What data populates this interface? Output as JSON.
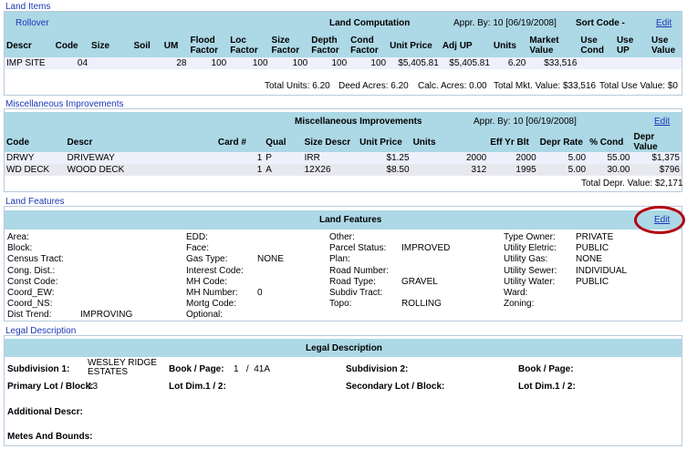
{
  "land_items": {
    "section_label": "Land Items",
    "rollover": "Rollover",
    "title": "Land Computation",
    "appr_by": "Appr. By: 10 [06/19/2008]",
    "sort_code": "Sort Code -",
    "edit": "Edit",
    "columns": [
      "Descr",
      "Code",
      "Size",
      "Soil",
      "UM",
      "Flood Factor",
      "Loc Factor",
      "Size Factor",
      "Depth Factor",
      "Cond Factor",
      "Unit Price",
      "Adj UP",
      "Units",
      "Market Value",
      "Use Cond",
      "Use UP",
      "Use Value"
    ],
    "rows": [
      [
        "IMP SITE",
        "04",
        "",
        "",
        "28",
        "100",
        "100",
        "100",
        "100",
        "100",
        "$5,405.81",
        "$5,405.81",
        "6.20",
        "$33,516",
        "",
        "",
        ""
      ]
    ],
    "totals": {
      "units": "Total Units: 6.20",
      "deed": "Deed Acres: 6.20",
      "calc": "Calc. Acres: 0.00",
      "mkt": "Total Mkt. Value: $33,516",
      "use": "Total Use Value: $0"
    }
  },
  "misc": {
    "section_label": "Miscellaneous Improvements",
    "title": "Miscellaneous Improvements",
    "appr_by": "Appr. By: 10 [06/19/2008]",
    "edit": "Edit",
    "columns": [
      "Code",
      "Descr",
      "Card #",
      "Qual",
      "Size Descr",
      "Unit Price",
      "Units",
      "Eff Yr Blt",
      "Depr Rate",
      "% Cond",
      "Depr Value"
    ],
    "rows": [
      [
        "DRWY",
        "DRIVEWAY",
        "1",
        "P",
        "IRR",
        "$1.25",
        "2000",
        "2000",
        "5.00",
        "55.00",
        "$1,375"
      ],
      [
        "WD DECK",
        "WOOD DECK",
        "1",
        "A",
        "12X26",
        "$8.50",
        "312",
        "1995",
        "5.00",
        "30.00",
        "$796"
      ]
    ],
    "total": "Total Depr. Value: $2,171"
  },
  "land_features": {
    "section_label": "Land Features",
    "title": "Land Features",
    "edit": "Edit",
    "col1": [
      {
        "label": "Area:",
        "value": ""
      },
      {
        "label": "Block:",
        "value": ""
      },
      {
        "label": "Census Tract:",
        "value": ""
      },
      {
        "label": "Cong. Dist.:",
        "value": ""
      },
      {
        "label": "Const Code:",
        "value": ""
      },
      {
        "label": "Coord_EW:",
        "value": ""
      },
      {
        "label": "Coord_NS:",
        "value": ""
      },
      {
        "label": "Dist Trend:",
        "value": "IMPROVING"
      }
    ],
    "col2": [
      {
        "label": "EDD:",
        "value": ""
      },
      {
        "label": "Face:",
        "value": ""
      },
      {
        "label": "Gas Type:",
        "value": "NONE"
      },
      {
        "label": "Interest Code:",
        "value": ""
      },
      {
        "label": "MH Code:",
        "value": ""
      },
      {
        "label": "MH Number:",
        "value": "0"
      },
      {
        "label": "Mortg Code:",
        "value": ""
      },
      {
        "label": "Optional:",
        "value": ""
      }
    ],
    "col3": [
      {
        "label": "Other:",
        "value": ""
      },
      {
        "label": "Parcel Status:",
        "value": "IMPROVED"
      },
      {
        "label": "Plan:",
        "value": ""
      },
      {
        "label": "Road Number:",
        "value": ""
      },
      {
        "label": "Road Type:",
        "value": "GRAVEL"
      },
      {
        "label": "Subdiv Tract:",
        "value": ""
      },
      {
        "label": "Topo:",
        "value": "ROLLING"
      }
    ],
    "col4": [
      {
        "label": "Type Owner:",
        "value": "PRIVATE"
      },
      {
        "label": "Utility Eletric:",
        "value": "PUBLIC"
      },
      {
        "label": "Utility Gas:",
        "value": "NONE"
      },
      {
        "label": "Utility Sewer:",
        "value": "INDIVIDUAL"
      },
      {
        "label": "Utility Water:",
        "value": "PUBLIC"
      },
      {
        "label": "Ward:",
        "value": ""
      },
      {
        "label": "Zoning:",
        "value": ""
      }
    ]
  },
  "legal": {
    "section_label": "Legal Description",
    "title": "Legal Description",
    "subdivision1_label": "Subdivision 1:",
    "subdivision1_value": "WESLEY RIDGE ESTATES",
    "book_page_label": "Book / Page:",
    "book_page_value": "1   /  41A",
    "subdivision2_label": "Subdivision 2:",
    "book_page2_label": "Book / Page:",
    "primary_lot_label": "Primary Lot / Block:",
    "primary_lot_value": "13",
    "lot_dim1_label": "Lot Dim.1 / 2:",
    "secondary_lot_label": "Secondary Lot / Block:",
    "lot_dim1b_label": "Lot Dim.1 / 2:",
    "additional_label": "Additional Descr:",
    "metes_label": "Metes And Bounds:"
  },
  "colors": {
    "header_bg": "#add8e6",
    "link": "#1a37b8",
    "row_alt": "#eef0fb",
    "highlight_circle": "#b30010"
  }
}
